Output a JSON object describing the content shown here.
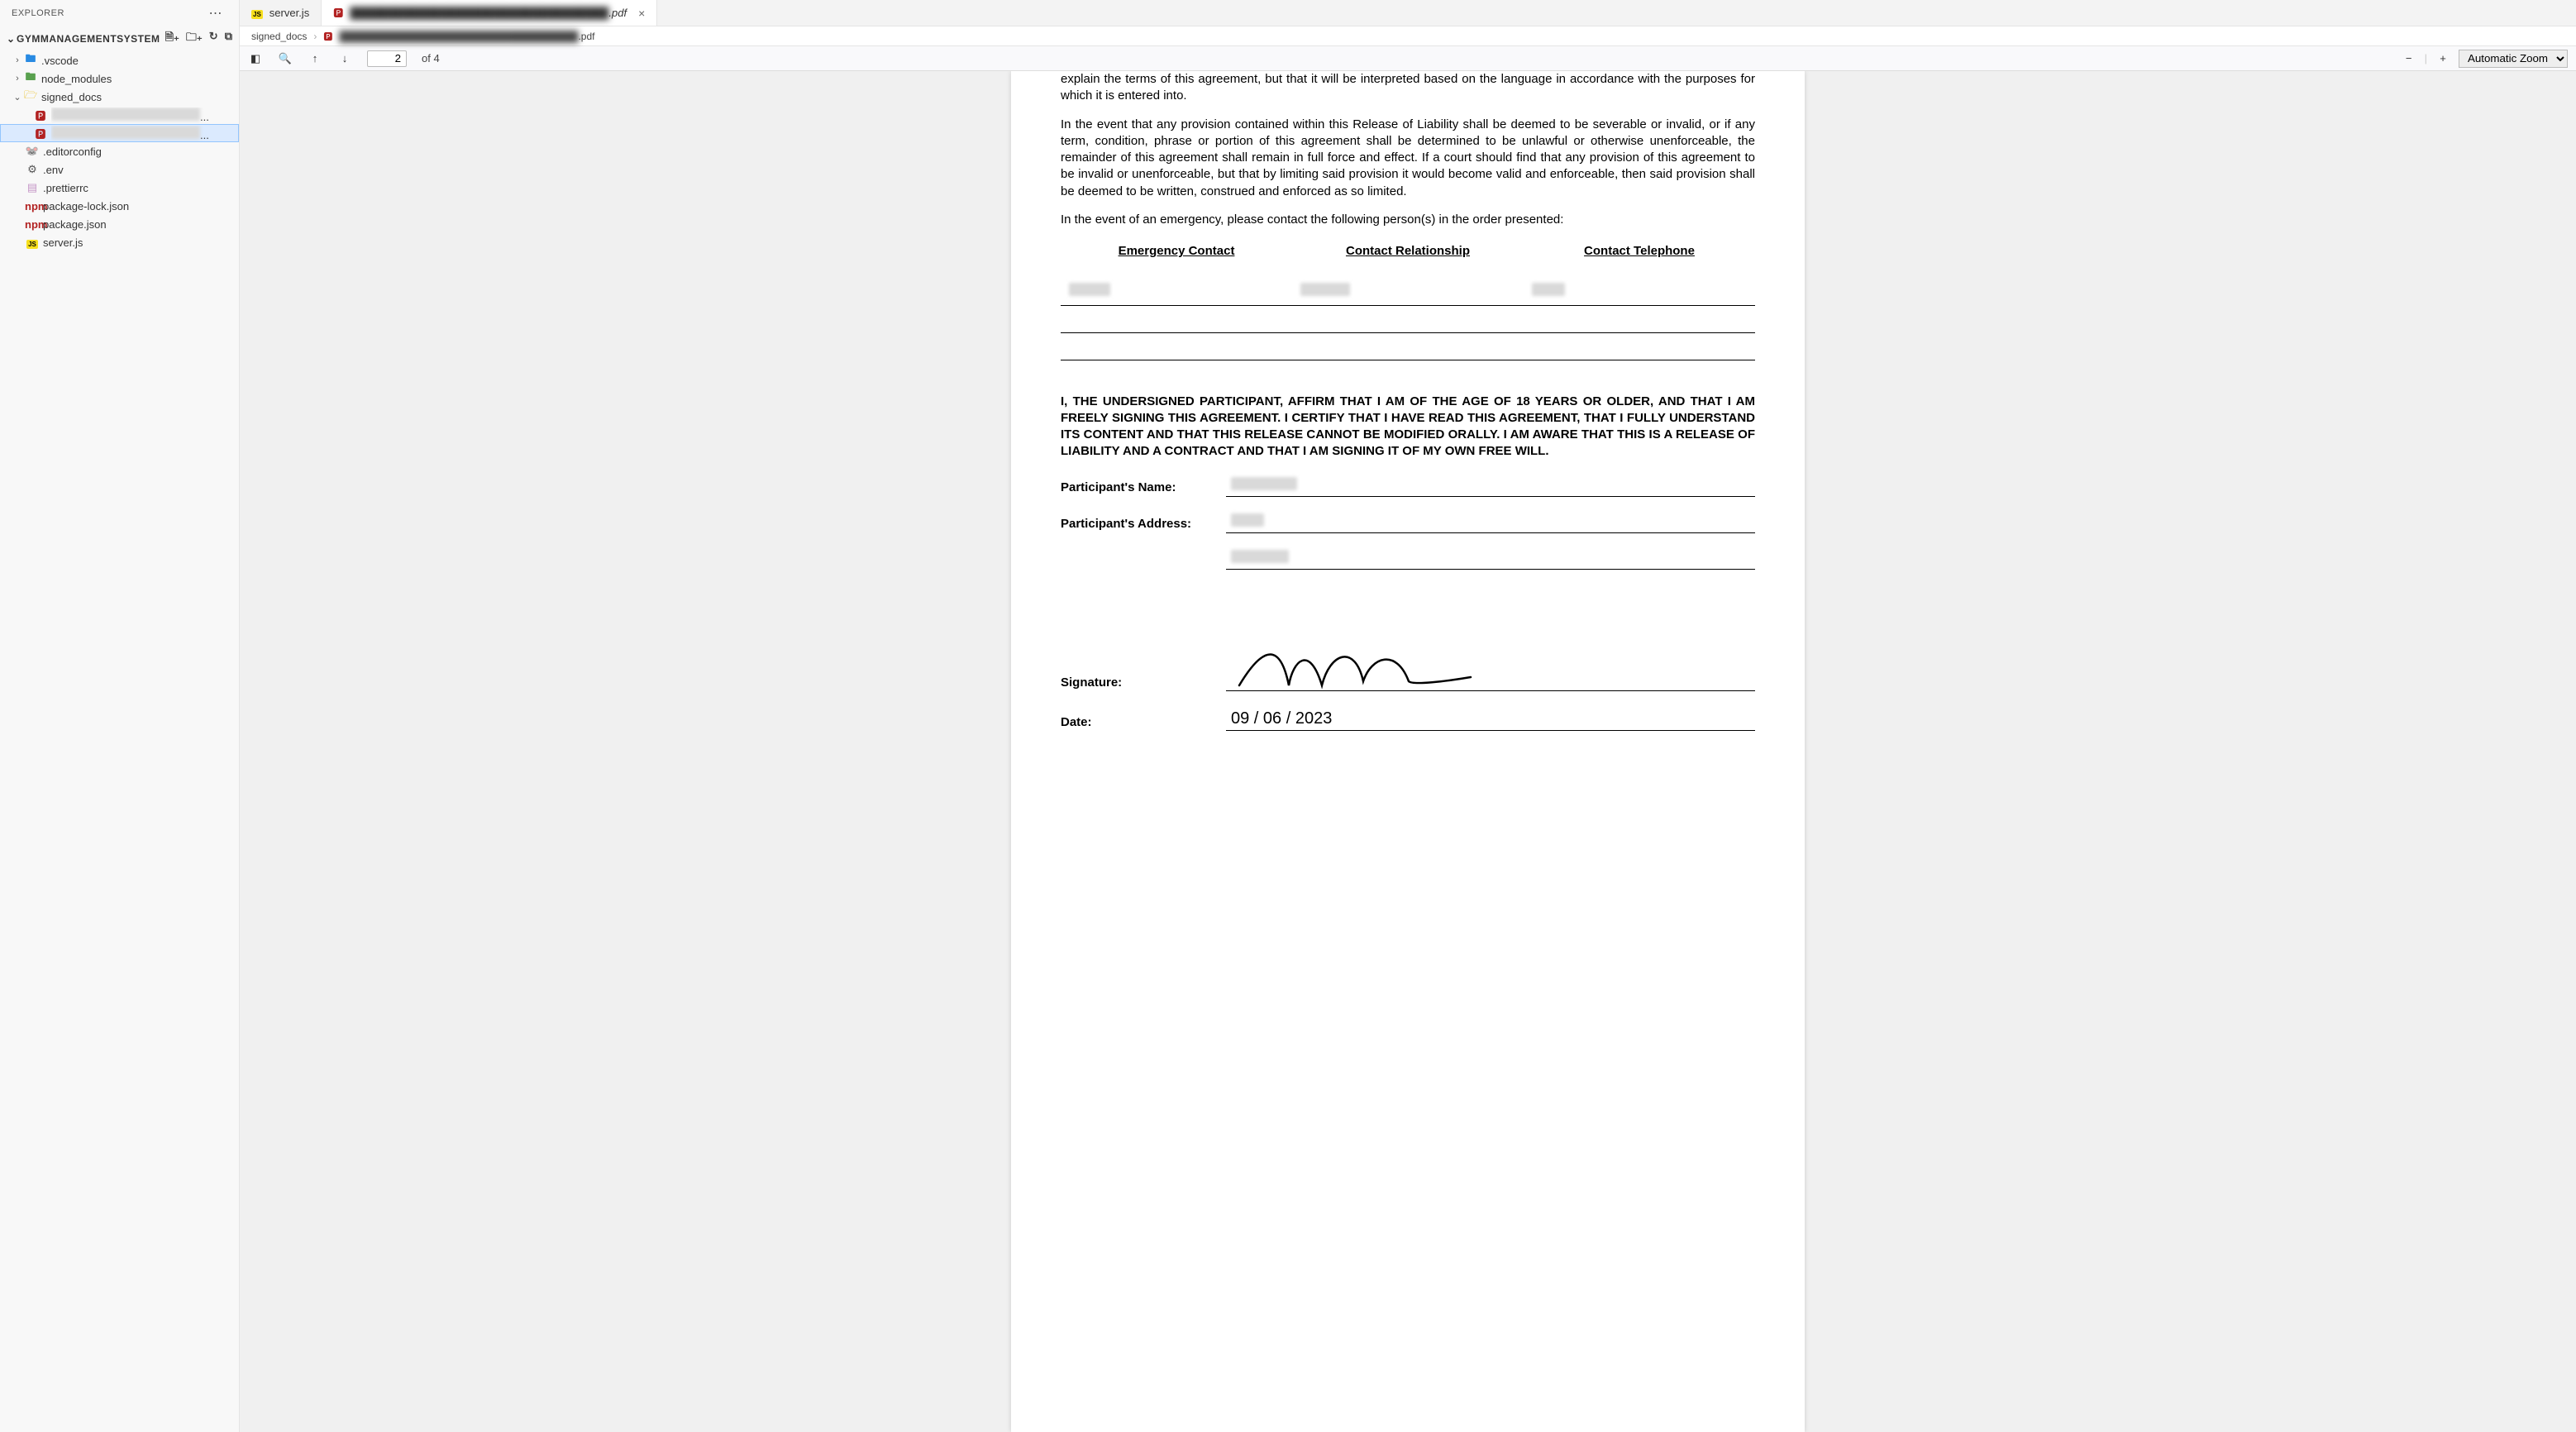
{
  "explorer": {
    "title": "EXPLORER",
    "project_name": "GYMMANAGEMENTSYSTEM",
    "tree": {
      "vscode": ".vscode",
      "node_modules": "node_modules",
      "signed_docs": "signed_docs",
      "pdf1": "████████████████████████...",
      "pdf2": "████████████████████████...",
      "editorconfig": ".editorconfig",
      "env": ".env",
      "prettierrc": ".prettierrc",
      "package_lock": "package-lock.json",
      "package_json": "package.json",
      "server_js": "server.js"
    }
  },
  "tabs": {
    "tab1_name": "server.js",
    "tab2_name_redacted": "██████████████████████████████████",
    "tab2_suffix": ".pdf"
  },
  "breadcrumb": {
    "folder": "signed_docs",
    "file_redacted": "██████████████████████████████████",
    "file_suffix": ".pdf"
  },
  "pdf_toolbar": {
    "current_page": "2",
    "page_of": "of 4",
    "zoom_selected": "Automatic Zoom"
  },
  "document": {
    "para1": "explain the terms of this agreement, but that it will be interpreted based on the language in accordance with the purposes for which it is entered into.",
    "para2": "In the event that any provision contained within this Release of Liability shall be deemed to be severable or invalid, or if any term, condition, phrase or portion of this agreement shall be determined to be unlawful or otherwise unenforceable, the remainder of this agreement shall remain in full force and effect. If a court should find that any provision of this agreement to be invalid or unenforceable, but that by limiting said provision it would become valid and enforceable, then said provision shall be deemed to be written, construed and enforced as so limited.",
    "para3": "In the event of an emergency, please contact the following person(s) in the order presented:",
    "contacts_headers": {
      "c1": "Emergency Contact",
      "c2": "Contact Relationship",
      "c3": "Contact Telephone"
    },
    "affirm": "I, THE UNDERSIGNED PARTICIPANT, AFFIRM THAT I AM OF THE AGE OF 18 YEARS OR OLDER, AND THAT I AM FREELY SIGNING THIS AGREEMENT. I CERTIFY THAT I HAVE READ THIS AGREEMENT, THAT I FULLY UNDERSTAND ITS CONTENT AND THAT THIS RELEASE CANNOT BE MODIFIED ORALLY. I AM AWARE THAT THIS IS A RELEASE OF LIABILITY AND A CONTRACT AND THAT I AM SIGNING IT OF MY OWN FREE WILL.",
    "labels": {
      "name": "Participant's Name:",
      "address": "Participant's Address:",
      "signature": "Signature:",
      "date": "Date:"
    },
    "date_value": "09 / 06 / 2023"
  }
}
